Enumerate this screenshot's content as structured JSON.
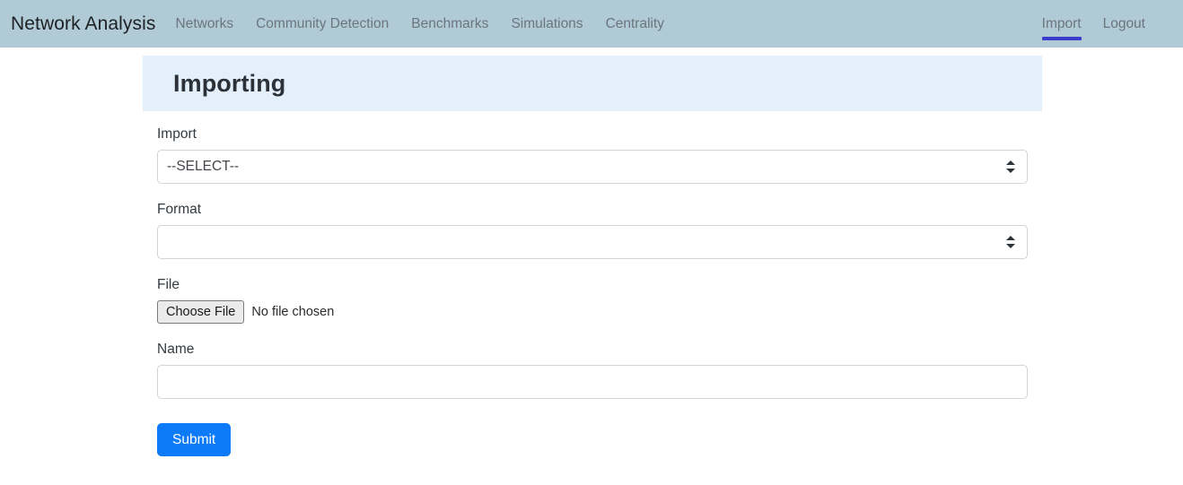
{
  "navbar": {
    "brand": "Network Analysis",
    "links": [
      {
        "label": "Networks"
      },
      {
        "label": "Community Detection"
      },
      {
        "label": "Benchmarks"
      },
      {
        "label": "Simulations"
      },
      {
        "label": "Centrality"
      }
    ],
    "right_links": [
      {
        "label": "Import",
        "active": true
      },
      {
        "label": "Logout",
        "active": false
      }
    ],
    "bg_color": "#b1cbd6",
    "active_underline_color": "#3c3ccc"
  },
  "page": {
    "header_title": "Importing",
    "header_bg_color": "#e3f0fb"
  },
  "form": {
    "import": {
      "label": "Import",
      "value": "--SELECT--",
      "icon": "select-arrows-icon"
    },
    "format": {
      "label": "Format",
      "value": "",
      "icon": "select-arrows-icon"
    },
    "file": {
      "label": "File",
      "button_label": "Choose File",
      "status": "No file chosen"
    },
    "name": {
      "label": "Name",
      "value": "",
      "placeholder": ""
    },
    "submit": {
      "label": "Submit",
      "color": "#0d7bf7"
    }
  }
}
